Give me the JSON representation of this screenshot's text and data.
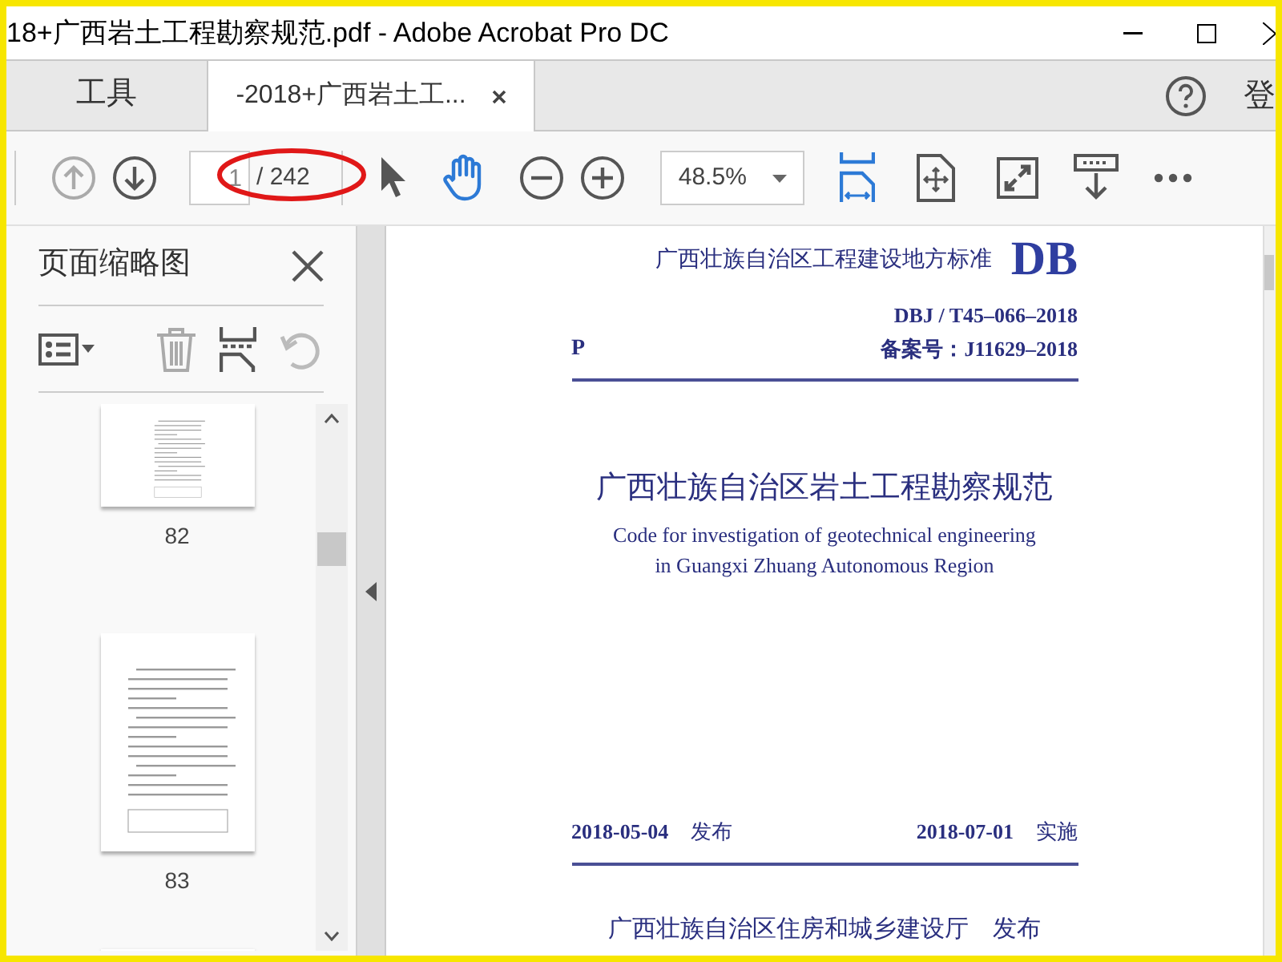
{
  "window": {
    "title": "18+广西岩土工程勘察规范.pdf - Adobe Acrobat Pro DC"
  },
  "tabs": [
    {
      "label": "工具",
      "selected": false
    },
    {
      "label": "-2018+广西岩土工...",
      "selected": true
    }
  ],
  "sign_in": "登",
  "toolbar": {
    "page_input": "1",
    "page_total": "/ 242",
    "zoom": "48.5%"
  },
  "sidebar": {
    "title": "页面缩略图",
    "thumbnails": [
      {
        "label": "82"
      },
      {
        "label": "83"
      }
    ]
  },
  "document": {
    "series": "广西壮族自治区工程建设地方标准",
    "logo": "DB",
    "code": "DBJ / T45–066–2018",
    "category": "P",
    "record": "备案号：J11629–2018",
    "title": "广西壮族自治区岩土工程勘察规范",
    "subtitle_lines": [
      "Code for investigation of geotechnical engineering",
      "in Guangxi Zhuang Autonomous Region"
    ],
    "dates": [
      {
        "date": "2018-05-04",
        "action": "发布"
      },
      {
        "date": "2018-07-01",
        "action": "实施"
      }
    ],
    "issuer": "广西壮族自治区住房和城乡建设厅　发布"
  }
}
